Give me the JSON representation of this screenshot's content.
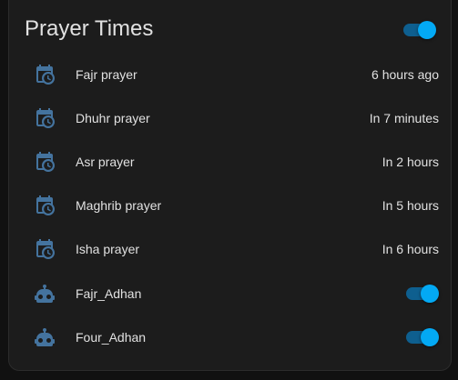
{
  "card": {
    "title": "Prayer Times",
    "header_toggle_on": true
  },
  "rows": [
    {
      "icon": "calendar-clock-icon",
      "name": "Fajr prayer",
      "state": "6 hours ago"
    },
    {
      "icon": "calendar-clock-icon",
      "name": "Dhuhr prayer",
      "state": "In 7 minutes"
    },
    {
      "icon": "calendar-clock-icon",
      "name": "Asr prayer",
      "state": "In 2 hours"
    },
    {
      "icon": "calendar-clock-icon",
      "name": "Maghrib prayer",
      "state": "In 5 hours"
    },
    {
      "icon": "calendar-clock-icon",
      "name": "Isha prayer",
      "state": "In 6 hours"
    },
    {
      "icon": "robot-icon",
      "name": "Fajr_Adhan",
      "toggle_on": true
    },
    {
      "icon": "robot-icon",
      "name": "Four_Adhan",
      "toggle_on": true
    }
  ],
  "colors": {
    "background": "#111111",
    "card": "#1c1c1c",
    "text": "#e1e1e1",
    "icon": "#44739e",
    "toggle_thumb": "#03a9f4",
    "toggle_track": "#0e5f8f"
  }
}
